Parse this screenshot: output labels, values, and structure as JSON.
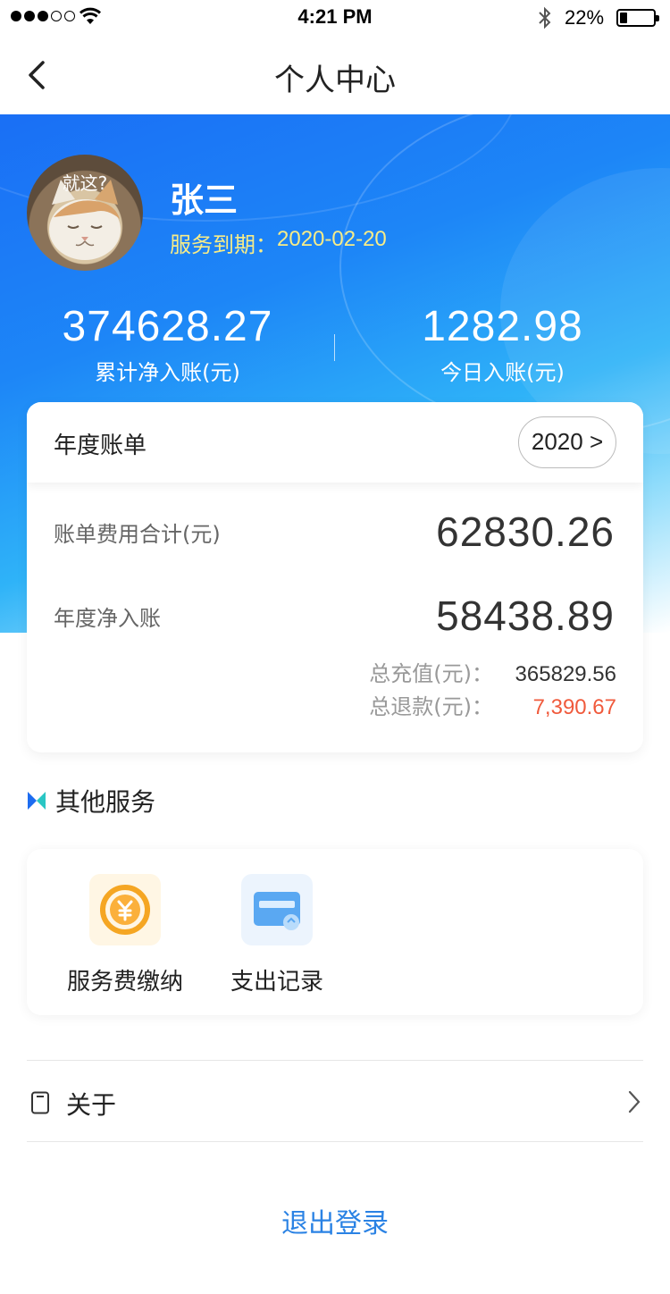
{
  "status_bar": {
    "time": "4:21 PM",
    "battery": "22%"
  },
  "nav": {
    "title": "个人中心"
  },
  "profile": {
    "avatar_caption": "就这?",
    "name": "张三",
    "expiry_label": "服务到期：",
    "expiry_date": "2020-02-20"
  },
  "stats": [
    {
      "value": "374628.27",
      "label": "累计净入账(元)"
    },
    {
      "value": "1282.98",
      "label": "今日入账(元)"
    }
  ],
  "annual_bill": {
    "title": "年度账单",
    "year_button": "2020 >",
    "total_fee_label": "账单费用合计(元)",
    "total_fee_value": "62830.26",
    "net_income_label": "年度净入账",
    "net_income_value": "58438.89",
    "recharge_label": "总充值(元)：",
    "recharge_value": "365829.56",
    "refund_label": "总退款(元)：",
    "refund_value": "7,390.67"
  },
  "other_services": {
    "title": "其他服务",
    "items": [
      {
        "label": "服务费缴纳",
        "icon": "yen-coin-icon"
      },
      {
        "label": "支出记录",
        "icon": "card-icon"
      }
    ]
  },
  "about": {
    "label": "关于"
  },
  "logout": {
    "label": "退出登录"
  },
  "colors": {
    "primary_blue": "#1d86f7",
    "expiry_yellow": "#f7ec88",
    "refund_red": "#f05a3c",
    "logout_blue": "#2a82e4"
  }
}
